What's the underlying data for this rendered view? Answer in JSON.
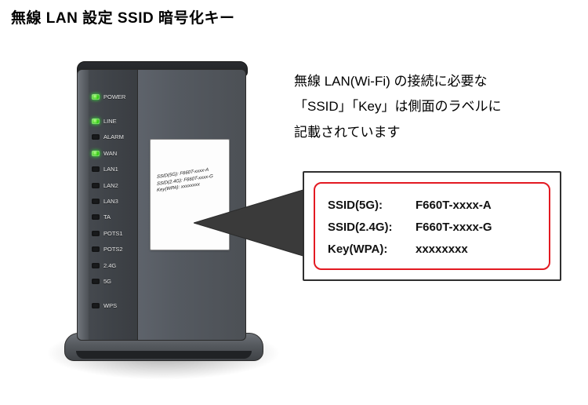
{
  "title": "無線 LAN 設定 SSID 暗号化キー",
  "description": {
    "line1": "無線 LAN(Wi-Fi) の接続に必要な",
    "line2": "「SSID」「Key」は側面のラベルに",
    "line3": "記載されています"
  },
  "router": {
    "leds": [
      {
        "name": "power",
        "label": "POWER",
        "color": "green-on"
      },
      {
        "gap": true
      },
      {
        "name": "line",
        "label": "LINE",
        "color": "green-on"
      },
      {
        "name": "alarm",
        "label": "ALARM",
        "color": "off"
      },
      {
        "name": "wan",
        "label": "WAN",
        "color": "green-on"
      },
      {
        "name": "lan1",
        "label": "LAN1",
        "color": "off"
      },
      {
        "name": "lan2",
        "label": "LAN2",
        "color": "off"
      },
      {
        "name": "lan3",
        "label": "LAN3",
        "color": "off"
      },
      {
        "name": "ta",
        "label": "TA",
        "color": "off"
      },
      {
        "name": "pots1",
        "label": "POTS1",
        "color": "off"
      },
      {
        "name": "pots2",
        "label": "POTS2",
        "color": "off"
      },
      {
        "name": "24g",
        "label": "2.4G",
        "color": "off"
      },
      {
        "name": "5g",
        "label": "5G",
        "color": "off"
      },
      {
        "gap": true
      },
      {
        "name": "wps",
        "label": "WPS",
        "color": "off"
      }
    ],
    "sticker": {
      "line1": "SSID(5G):    F660T-xxxx-A",
      "line2": "SSID(2.4G): F660T-xxxx-G",
      "line3": "Key(WPA):  xxxxxxxx"
    }
  },
  "callout": {
    "rows": [
      {
        "key": "SSID(5G):",
        "val": "F660T-xxxx-A"
      },
      {
        "key": "SSID(2.4G):",
        "val": "F660T-xxxx-G"
      },
      {
        "key": "Key(WPA):",
        "val": "xxxxxxxx"
      }
    ]
  },
  "colors": {
    "highlightBorder": "#e31a22",
    "panelDark": "#3f4348",
    "panelLight": "#5e636b"
  }
}
